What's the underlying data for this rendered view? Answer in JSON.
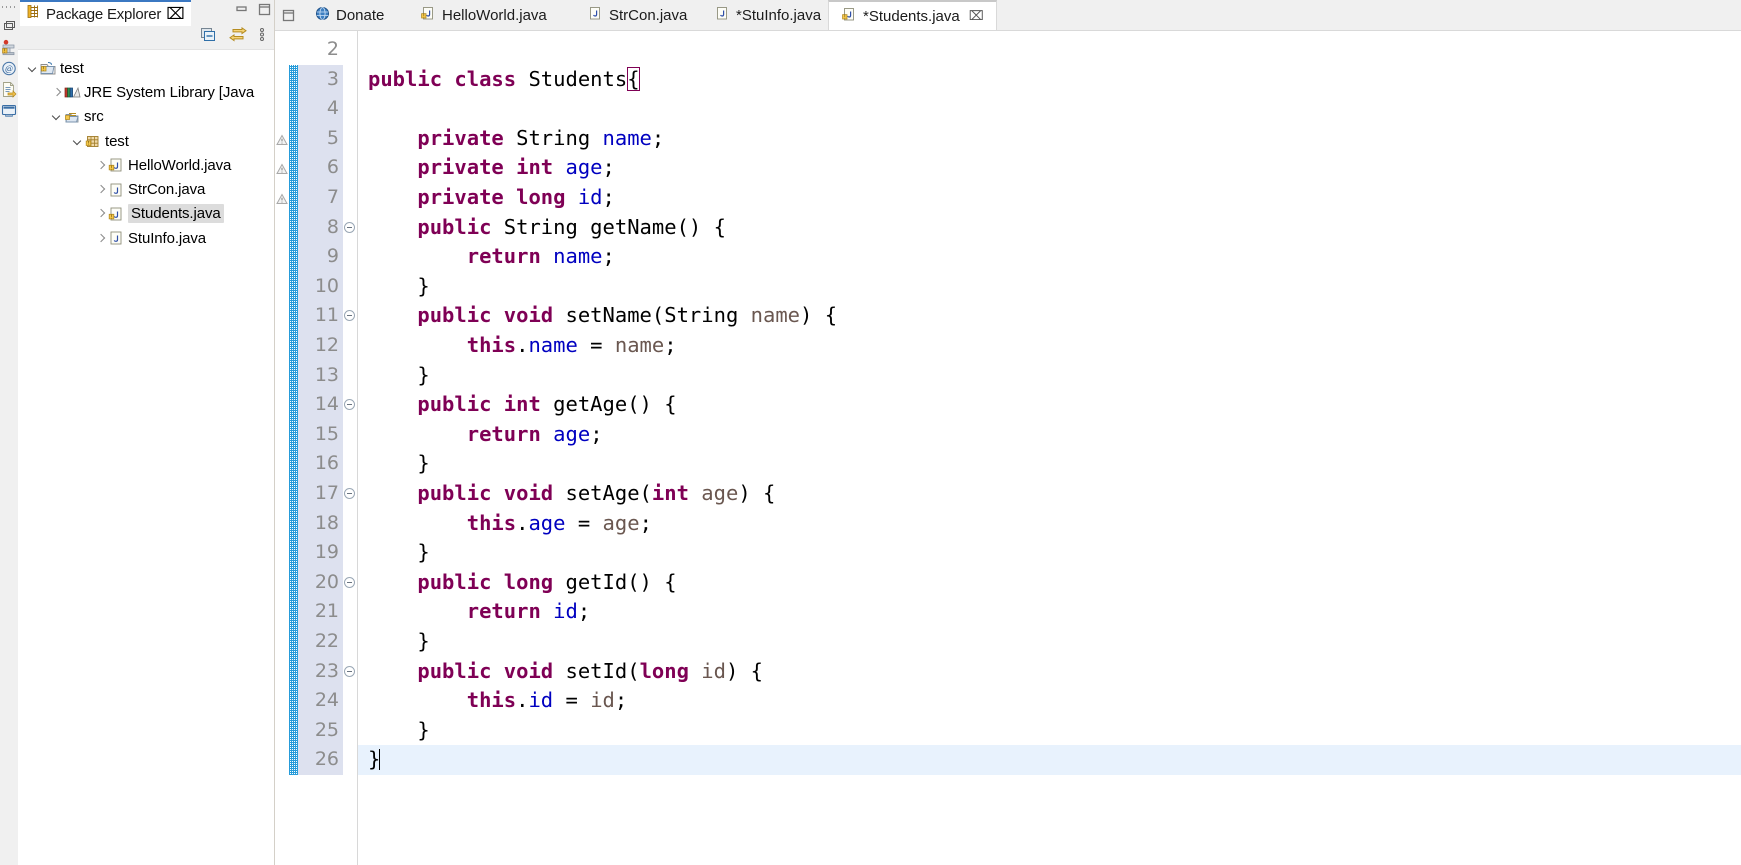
{
  "window": {
    "minimize_label": "Minimize",
    "maximize_label": "Maximize"
  },
  "fastview": {
    "items": [
      {
        "name": "restore-view-icon",
        "label": "Restore"
      },
      {
        "name": "package-explorer-fastview-icon",
        "label": "Package Explorer"
      },
      {
        "name": "javadoc-fastview-icon",
        "label": "Javadoc"
      },
      {
        "name": "declaration-fastview-icon",
        "label": "Declaration"
      },
      {
        "name": "console-fastview-icon",
        "label": "Console"
      }
    ]
  },
  "package_explorer": {
    "title": "Package Explorer",
    "close_label": "⌧",
    "toolbar": [
      {
        "name": "collapse-all-icon",
        "label": "Collapse All"
      },
      {
        "name": "link-with-editor-icon",
        "label": "Link with Editor"
      },
      {
        "name": "view-menu-icon",
        "label": "View Menu"
      }
    ],
    "tree": [
      {
        "label": "test",
        "depth": 0,
        "twisty": "down",
        "icon": "java-project-icon",
        "selected": false
      },
      {
        "label": "JRE System Library [Java",
        "depth": 1,
        "twisty": "right",
        "icon": "library-icon",
        "selected": false
      },
      {
        "label": "src",
        "depth": 1,
        "twisty": "down",
        "icon": "source-folder-icon",
        "selected": false
      },
      {
        "label": "test",
        "depth": 2,
        "twisty": "down",
        "icon": "package-icon",
        "selected": false
      },
      {
        "label": "HelloWorld.java",
        "depth": 3,
        "twisty": "right",
        "icon": "java-file-warning-icon",
        "selected": false
      },
      {
        "label": "StrCon.java",
        "depth": 3,
        "twisty": "right",
        "icon": "java-file-icon",
        "selected": false
      },
      {
        "label": "Students.java",
        "depth": 3,
        "twisty": "right",
        "icon": "java-file-warning-icon",
        "selected": true
      },
      {
        "label": "StuInfo.java",
        "depth": 3,
        "twisty": "right",
        "icon": "java-file-icon",
        "selected": false
      }
    ]
  },
  "editor_tabs": [
    {
      "label": "Donate",
      "icon": "globe-icon",
      "dirty": false,
      "active": false,
      "closable": false
    },
    {
      "label": "HelloWorld.java",
      "icon": "java-file-warning-icon",
      "dirty": false,
      "active": false,
      "closable": false
    },
    {
      "label": "StrCon.java",
      "icon": "java-file-icon",
      "dirty": false,
      "active": false,
      "closable": false
    },
    {
      "label": "*StuInfo.java",
      "icon": "java-file-icon",
      "dirty": true,
      "active": false,
      "closable": false
    },
    {
      "label": "*Students.java",
      "icon": "java-file-warning-icon",
      "dirty": true,
      "active": true,
      "closable": true,
      "close_label": "⌧"
    }
  ],
  "code": {
    "first_visible_line": 2,
    "current_line": 26,
    "lines": [
      {
        "n": 2,
        "fold": null,
        "warn": false,
        "changed": false,
        "tokens": []
      },
      {
        "n": 3,
        "fold": null,
        "warn": false,
        "changed": true,
        "tokens": [
          {
            "t": "public",
            "c": "kw"
          },
          {
            "t": " ",
            "c": "pln"
          },
          {
            "t": "class",
            "c": "kw"
          },
          {
            "t": " Students",
            "c": "pln"
          },
          {
            "t": "{",
            "c": "caret-brace"
          }
        ]
      },
      {
        "n": 4,
        "fold": null,
        "warn": false,
        "changed": true,
        "tokens": []
      },
      {
        "n": 5,
        "fold": null,
        "warn": true,
        "changed": true,
        "tokens": [
          {
            "t": "    ",
            "c": "pln"
          },
          {
            "t": "private",
            "c": "kw"
          },
          {
            "t": " String ",
            "c": "pln"
          },
          {
            "t": "name",
            "c": "fld"
          },
          {
            "t": ";",
            "c": "pln"
          }
        ]
      },
      {
        "n": 6,
        "fold": null,
        "warn": true,
        "changed": true,
        "tokens": [
          {
            "t": "    ",
            "c": "pln"
          },
          {
            "t": "private",
            "c": "kw"
          },
          {
            "t": " ",
            "c": "pln"
          },
          {
            "t": "int",
            "c": "kw"
          },
          {
            "t": " ",
            "c": "pln"
          },
          {
            "t": "age",
            "c": "fld"
          },
          {
            "t": ";",
            "c": "pln"
          }
        ]
      },
      {
        "n": 7,
        "fold": null,
        "warn": true,
        "changed": true,
        "tokens": [
          {
            "t": "    ",
            "c": "pln"
          },
          {
            "t": "private",
            "c": "kw"
          },
          {
            "t": " ",
            "c": "pln"
          },
          {
            "t": "long",
            "c": "kw"
          },
          {
            "t": " ",
            "c": "pln"
          },
          {
            "t": "id",
            "c": "fld"
          },
          {
            "t": ";",
            "c": "pln"
          }
        ]
      },
      {
        "n": 8,
        "fold": "collapse",
        "warn": false,
        "changed": true,
        "tokens": [
          {
            "t": "    ",
            "c": "pln"
          },
          {
            "t": "public",
            "c": "kw"
          },
          {
            "t": " String getName() {",
            "c": "pln"
          }
        ]
      },
      {
        "n": 9,
        "fold": null,
        "warn": false,
        "changed": true,
        "tokens": [
          {
            "t": "        ",
            "c": "pln"
          },
          {
            "t": "return",
            "c": "kw"
          },
          {
            "t": " ",
            "c": "pln"
          },
          {
            "t": "name",
            "c": "fld"
          },
          {
            "t": ";",
            "c": "pln"
          }
        ]
      },
      {
        "n": 10,
        "fold": null,
        "warn": false,
        "changed": true,
        "tokens": [
          {
            "t": "    }",
            "c": "pln"
          }
        ]
      },
      {
        "n": 11,
        "fold": "collapse",
        "warn": false,
        "changed": true,
        "tokens": [
          {
            "t": "    ",
            "c": "pln"
          },
          {
            "t": "public",
            "c": "kw"
          },
          {
            "t": " ",
            "c": "pln"
          },
          {
            "t": "void",
            "c": "kw"
          },
          {
            "t": " setName(String ",
            "c": "pln"
          },
          {
            "t": "name",
            "c": "prm"
          },
          {
            "t": ") {",
            "c": "pln"
          }
        ]
      },
      {
        "n": 12,
        "fold": null,
        "warn": false,
        "changed": true,
        "tokens": [
          {
            "t": "        ",
            "c": "pln"
          },
          {
            "t": "this",
            "c": "kw"
          },
          {
            "t": ".",
            "c": "pln"
          },
          {
            "t": "name",
            "c": "fld"
          },
          {
            "t": " = ",
            "c": "pln"
          },
          {
            "t": "name",
            "c": "prm"
          },
          {
            "t": ";",
            "c": "pln"
          }
        ]
      },
      {
        "n": 13,
        "fold": null,
        "warn": false,
        "changed": true,
        "tokens": [
          {
            "t": "    }",
            "c": "pln"
          }
        ]
      },
      {
        "n": 14,
        "fold": "collapse",
        "warn": false,
        "changed": true,
        "tokens": [
          {
            "t": "    ",
            "c": "pln"
          },
          {
            "t": "public",
            "c": "kw"
          },
          {
            "t": " ",
            "c": "pln"
          },
          {
            "t": "int",
            "c": "kw"
          },
          {
            "t": " getAge() {",
            "c": "pln"
          }
        ]
      },
      {
        "n": 15,
        "fold": null,
        "warn": false,
        "changed": true,
        "tokens": [
          {
            "t": "        ",
            "c": "pln"
          },
          {
            "t": "return",
            "c": "kw"
          },
          {
            "t": " ",
            "c": "pln"
          },
          {
            "t": "age",
            "c": "fld"
          },
          {
            "t": ";",
            "c": "pln"
          }
        ]
      },
      {
        "n": 16,
        "fold": null,
        "warn": false,
        "changed": true,
        "tokens": [
          {
            "t": "    }",
            "c": "pln"
          }
        ]
      },
      {
        "n": 17,
        "fold": "collapse",
        "warn": false,
        "changed": true,
        "tokens": [
          {
            "t": "    ",
            "c": "pln"
          },
          {
            "t": "public",
            "c": "kw"
          },
          {
            "t": " ",
            "c": "pln"
          },
          {
            "t": "void",
            "c": "kw"
          },
          {
            "t": " setAge(",
            "c": "pln"
          },
          {
            "t": "int",
            "c": "kw"
          },
          {
            "t": " ",
            "c": "pln"
          },
          {
            "t": "age",
            "c": "prm"
          },
          {
            "t": ") {",
            "c": "pln"
          }
        ]
      },
      {
        "n": 18,
        "fold": null,
        "warn": false,
        "changed": true,
        "tokens": [
          {
            "t": "        ",
            "c": "pln"
          },
          {
            "t": "this",
            "c": "kw"
          },
          {
            "t": ".",
            "c": "pln"
          },
          {
            "t": "age",
            "c": "fld"
          },
          {
            "t": " = ",
            "c": "pln"
          },
          {
            "t": "age",
            "c": "prm"
          },
          {
            "t": ";",
            "c": "pln"
          }
        ]
      },
      {
        "n": 19,
        "fold": null,
        "warn": false,
        "changed": true,
        "tokens": [
          {
            "t": "    }",
            "c": "pln"
          }
        ]
      },
      {
        "n": 20,
        "fold": "collapse",
        "warn": false,
        "changed": true,
        "tokens": [
          {
            "t": "    ",
            "c": "pln"
          },
          {
            "t": "public",
            "c": "kw"
          },
          {
            "t": " ",
            "c": "pln"
          },
          {
            "t": "long",
            "c": "kw"
          },
          {
            "t": " getId() {",
            "c": "pln"
          }
        ]
      },
      {
        "n": 21,
        "fold": null,
        "warn": false,
        "changed": true,
        "tokens": [
          {
            "t": "        ",
            "c": "pln"
          },
          {
            "t": "return",
            "c": "kw"
          },
          {
            "t": " ",
            "c": "pln"
          },
          {
            "t": "id",
            "c": "fld"
          },
          {
            "t": ";",
            "c": "pln"
          }
        ]
      },
      {
        "n": 22,
        "fold": null,
        "warn": false,
        "changed": true,
        "tokens": [
          {
            "t": "    }",
            "c": "pln"
          }
        ]
      },
      {
        "n": 23,
        "fold": "collapse",
        "warn": false,
        "changed": true,
        "tokens": [
          {
            "t": "    ",
            "c": "pln"
          },
          {
            "t": "public",
            "c": "kw"
          },
          {
            "t": " ",
            "c": "pln"
          },
          {
            "t": "void",
            "c": "kw"
          },
          {
            "t": " setId(",
            "c": "pln"
          },
          {
            "t": "long",
            "c": "kw"
          },
          {
            "t": " ",
            "c": "pln"
          },
          {
            "t": "id",
            "c": "prm"
          },
          {
            "t": ") {",
            "c": "pln"
          }
        ]
      },
      {
        "n": 24,
        "fold": null,
        "warn": false,
        "changed": true,
        "tokens": [
          {
            "t": "        ",
            "c": "pln"
          },
          {
            "t": "this",
            "c": "kw"
          },
          {
            "t": ".",
            "c": "pln"
          },
          {
            "t": "id",
            "c": "fld"
          },
          {
            "t": " = ",
            "c": "pln"
          },
          {
            "t": "id",
            "c": "prm"
          },
          {
            "t": ";",
            "c": "pln"
          }
        ]
      },
      {
        "n": 25,
        "fold": null,
        "warn": false,
        "changed": true,
        "tokens": [
          {
            "t": "    }",
            "c": "pln"
          }
        ]
      },
      {
        "n": 26,
        "fold": null,
        "warn": false,
        "changed": true,
        "tokens": [
          {
            "t": "}",
            "c": "pln"
          },
          {
            "t": "",
            "c": "caret"
          }
        ]
      }
    ]
  },
  "colors": {
    "keyword": "#7f0055",
    "field": "#0000c0",
    "parameter": "#6a5750",
    "plain": "#000000",
    "line_number": "#8c8c8c",
    "current_line_bg": "#e8f2fd",
    "current_linenum_bg": "#dde1ef",
    "change_stripe": "#1b96d8",
    "selection_bg": "#dcdcdc",
    "chrome_bg": "#f0f0f0",
    "active_tab_border": "#3b78c2"
  }
}
